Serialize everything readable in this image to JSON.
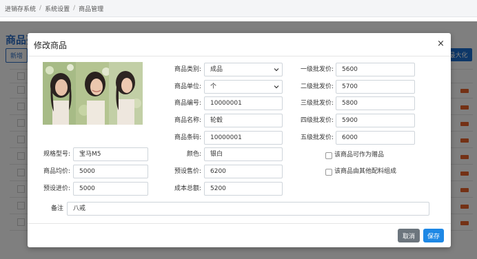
{
  "breadcrumb": {
    "items": [
      "进销存系统",
      "系统设置",
      "商品管理"
    ],
    "separator": "/"
  },
  "background": {
    "page_title": "商品列表",
    "add_label": "新增",
    "maximize_label": "最大化"
  },
  "modal": {
    "title": "修改商品",
    "close_symbol": "×",
    "fields": {
      "category": {
        "label": "商品类别:",
        "value": "成品"
      },
      "unit": {
        "label": "商品单位:",
        "value": "个"
      },
      "code": {
        "label": "商品编号:",
        "value": "10000001"
      },
      "name": {
        "label": "商品名称:",
        "value": "轮毂"
      },
      "barcode": {
        "label": "商品条码:",
        "value": "10000001"
      },
      "spec": {
        "label": "规格型号:",
        "value": "宝马M5"
      },
      "color": {
        "label": "颜色:",
        "value": "银白"
      },
      "avg_price": {
        "label": "商品均价:",
        "value": "5000"
      },
      "preset_sale": {
        "label": "预设售价:",
        "value": "6200"
      },
      "preset_purchase": {
        "label": "预设进价:",
        "value": "5000"
      },
      "total_cost": {
        "label": "成本总额:",
        "value": "5200"
      },
      "wholesale1": {
        "label": "一级批发价:",
        "value": "5600"
      },
      "wholesale2": {
        "label": "二级批发价:",
        "value": "5700"
      },
      "wholesale3": {
        "label": "三级批发价:",
        "value": "5800"
      },
      "wholesale4": {
        "label": "四级批发价:",
        "value": "5900"
      },
      "wholesale5": {
        "label": "五级批发价:",
        "value": "6000"
      },
      "remark": {
        "label": "备注",
        "value": "八戒"
      }
    },
    "checkboxes": {
      "gift": {
        "label": "该商品可作为赠品",
        "checked": false
      },
      "composed": {
        "label": "该商品由其他配料组成",
        "checked": false
      }
    },
    "buttons": {
      "cancel": "取消",
      "save": "保存"
    }
  },
  "colors": {
    "primary": "#1e88e5",
    "secondary": "#6c757d",
    "link": "#2d6fc7",
    "tag": "#e8632b"
  }
}
